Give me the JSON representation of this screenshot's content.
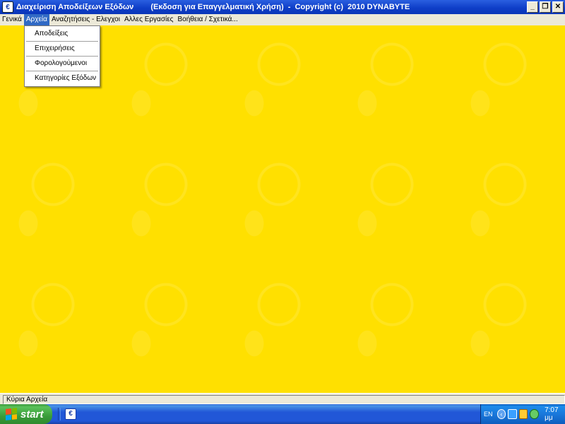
{
  "window": {
    "title": "Διαχείριση Αποδείξεων Εξόδων",
    "caption": "(Εκδοση για Επαγγελματική Χρήση)  -  Copyright (c)  2010 DYNABYTE",
    "controls": {
      "minimize": "_",
      "restore": "❐",
      "close": "✕"
    }
  },
  "menubar": {
    "items": [
      {
        "label": "Γενικά"
      },
      {
        "label": "Αρχεία",
        "active": true
      },
      {
        "label": "Αναζητήσεις - Ελεγχοι"
      },
      {
        "label": "Αλλες Εργασίες"
      },
      {
        "label": "Βοήθεια / Σχετικά..."
      }
    ]
  },
  "dropdown": {
    "items": [
      {
        "label": "Αποδείξεις"
      },
      {
        "label": "Επιχειρήσεις"
      },
      {
        "label": "Φορολογούμενοι"
      },
      {
        "label": "Κατηγορίες Εξόδων"
      }
    ]
  },
  "statusbar": {
    "text": "Κύρια Αρχεία"
  },
  "taskbar": {
    "start_label": "start",
    "language": "EN",
    "clock": "7:07 μμ"
  },
  "colors": {
    "workspace": "#FFE000",
    "menu_highlight": "#316AC5",
    "titlebar": "#0F3FC8"
  }
}
